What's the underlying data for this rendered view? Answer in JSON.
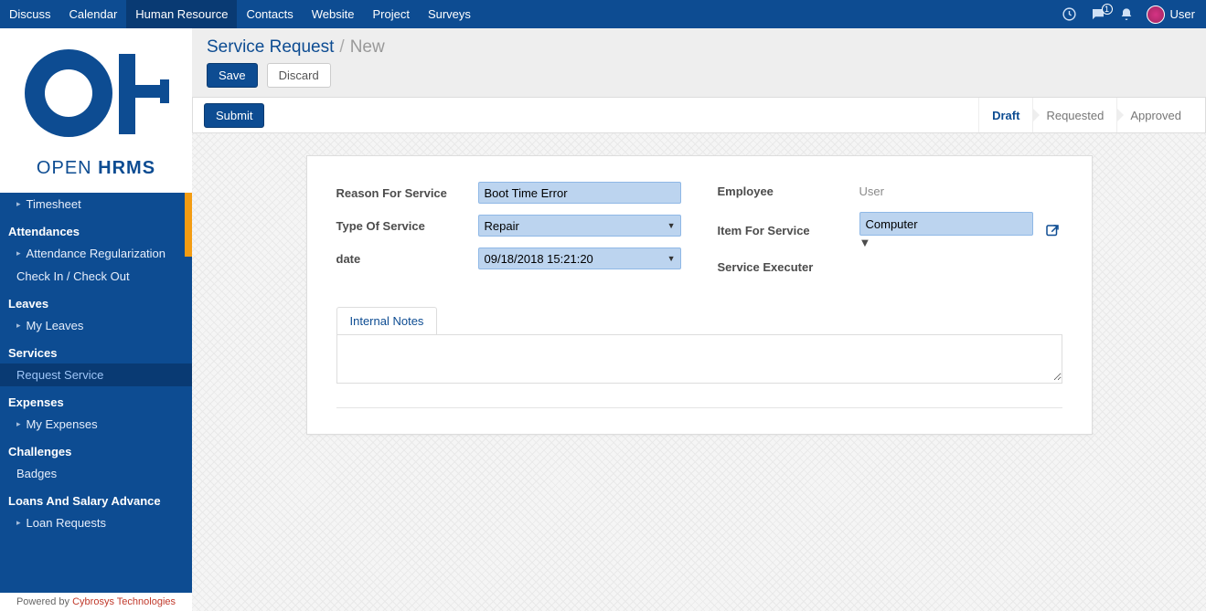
{
  "topnav": {
    "items": [
      "Discuss",
      "Calendar",
      "Human Resource",
      "Contacts",
      "Website",
      "Project",
      "Surveys"
    ],
    "active_index": 2,
    "chat_badge": "1",
    "user_name": "User"
  },
  "logo": {
    "line1": "OPEN",
    "line2": "HRMS"
  },
  "sidebar": [
    {
      "type": "item",
      "label": "Timesheet",
      "caret": true
    },
    {
      "type": "section",
      "label": "Attendances"
    },
    {
      "type": "item",
      "label": "Attendance Regularization",
      "caret": true
    },
    {
      "type": "item",
      "label": "Check In / Check Out",
      "caret": false
    },
    {
      "type": "section",
      "label": "Leaves"
    },
    {
      "type": "item",
      "label": "My Leaves",
      "caret": true
    },
    {
      "type": "section",
      "label": "Services"
    },
    {
      "type": "item",
      "label": "Request Service",
      "caret": false,
      "active": true
    },
    {
      "type": "section",
      "label": "Expenses"
    },
    {
      "type": "item",
      "label": "My Expenses",
      "caret": true
    },
    {
      "type": "section",
      "label": "Challenges"
    },
    {
      "type": "item",
      "label": "Badges",
      "caret": false
    },
    {
      "type": "section",
      "label": "Loans And Salary Advance"
    },
    {
      "type": "item",
      "label": "Loan Requests",
      "caret": true
    }
  ],
  "footer": {
    "prefix": "Powered by ",
    "brand": "Cybrosys Technologies"
  },
  "breadcrumb": {
    "root": "Service Request",
    "current": "New"
  },
  "actions": {
    "save": "Save",
    "discard": "Discard"
  },
  "status_bar": {
    "submit": "Submit",
    "steps": [
      "Draft",
      "Requested",
      "Approved"
    ],
    "active_step": 0
  },
  "form": {
    "left": {
      "reason_label": "Reason For Service",
      "reason_value": "Boot Time Error",
      "type_label": "Type Of Service",
      "type_value": "Repair",
      "date_label": "date",
      "date_value": "09/18/2018 15:21:20"
    },
    "right": {
      "employee_label": "Employee",
      "employee_value": "User",
      "item_label": "Item For Service",
      "item_value": "Computer",
      "executer_label": "Service Executer",
      "executer_value": ""
    },
    "tabs": {
      "internal_notes": "Internal Notes"
    },
    "notes_value": ""
  }
}
